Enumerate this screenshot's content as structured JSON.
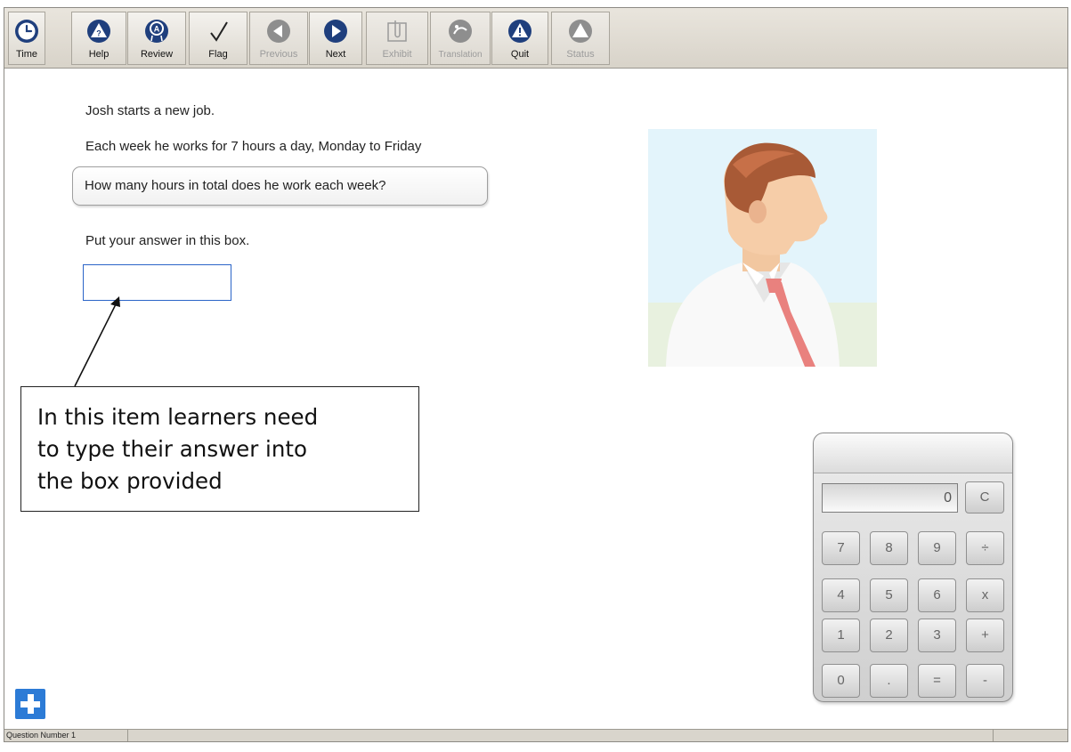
{
  "toolbar": {
    "buttons": [
      {
        "label": "Time",
        "icon": "clock-icon"
      },
      {
        "label": "Help",
        "icon": "help-icon"
      },
      {
        "label": "Review",
        "icon": "review-icon"
      },
      {
        "label": "Flag",
        "icon": "checkmark-icon"
      },
      {
        "label": "Previous",
        "icon": "previous-arrow-icon",
        "enabled": false
      },
      {
        "label": "Next",
        "icon": "next-arrow-icon"
      },
      {
        "label": "Exhibit",
        "icon": "paperclip-icon",
        "enabled": false
      },
      {
        "label": "Translation",
        "icon": "translation-icon",
        "enabled": false
      },
      {
        "label": "Quit",
        "icon": "warning-icon"
      },
      {
        "label": "Status",
        "icon": "status-icon",
        "enabled": false
      }
    ]
  },
  "question": {
    "line1": "Josh starts a new job.",
    "line2": "Each week he works for 7 hours a day, Monday to Friday",
    "prompt": "How many hours in total does he work each week?",
    "instruction": "Put your answer in this box.",
    "answer_value": ""
  },
  "callout": {
    "line1": "In this item learners need",
    "line2": "to type their answer into",
    "line3": "the box provided"
  },
  "calculator": {
    "display": "0",
    "clear_key": "C",
    "keys": [
      [
        "7",
        "8",
        "9",
        "÷"
      ],
      [
        "4",
        "5",
        "6",
        "x"
      ],
      [
        "1",
        "2",
        "3",
        "+"
      ],
      [
        "0",
        ".",
        "=",
        "-"
      ]
    ]
  },
  "statusbar": {
    "question_number": "Question Number 1"
  },
  "colors": {
    "icon_navy": "#1f3f7d",
    "icon_disabled": "#8e8e8e",
    "input_border": "#2b64c8",
    "plus_button": "#2c7bd6"
  }
}
